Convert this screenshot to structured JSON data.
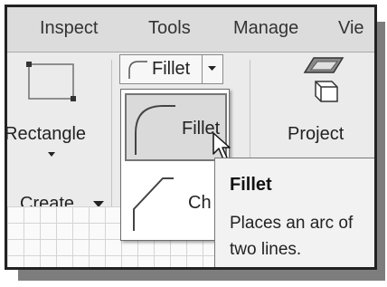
{
  "tabs": [
    {
      "label": "Inspect"
    },
    {
      "label": "Tools"
    },
    {
      "label": "Manage"
    },
    {
      "label": "Vie"
    }
  ],
  "ribbon": {
    "rectangle": {
      "label": "Rectangle"
    },
    "create_panel": {
      "label": "Create"
    },
    "fillet_split_button": {
      "label": "Fillet"
    },
    "project": {
      "label": "Project"
    }
  },
  "dropdown": {
    "items": [
      {
        "label": "Fillet",
        "icon": "fillet-icon",
        "selected": true
      },
      {
        "label": "Ch",
        "icon": "chamfer-icon",
        "selected": false
      }
    ]
  },
  "tooltip": {
    "title": "Fillet",
    "lines": [
      "Places an arc of",
      "two lines."
    ]
  },
  "colors": {
    "tab_bar": "#dcdcdc",
    "ribbon": "#ebebeb",
    "selected_item": "#dadada",
    "tooltip_bg": "#f2f2f2"
  }
}
